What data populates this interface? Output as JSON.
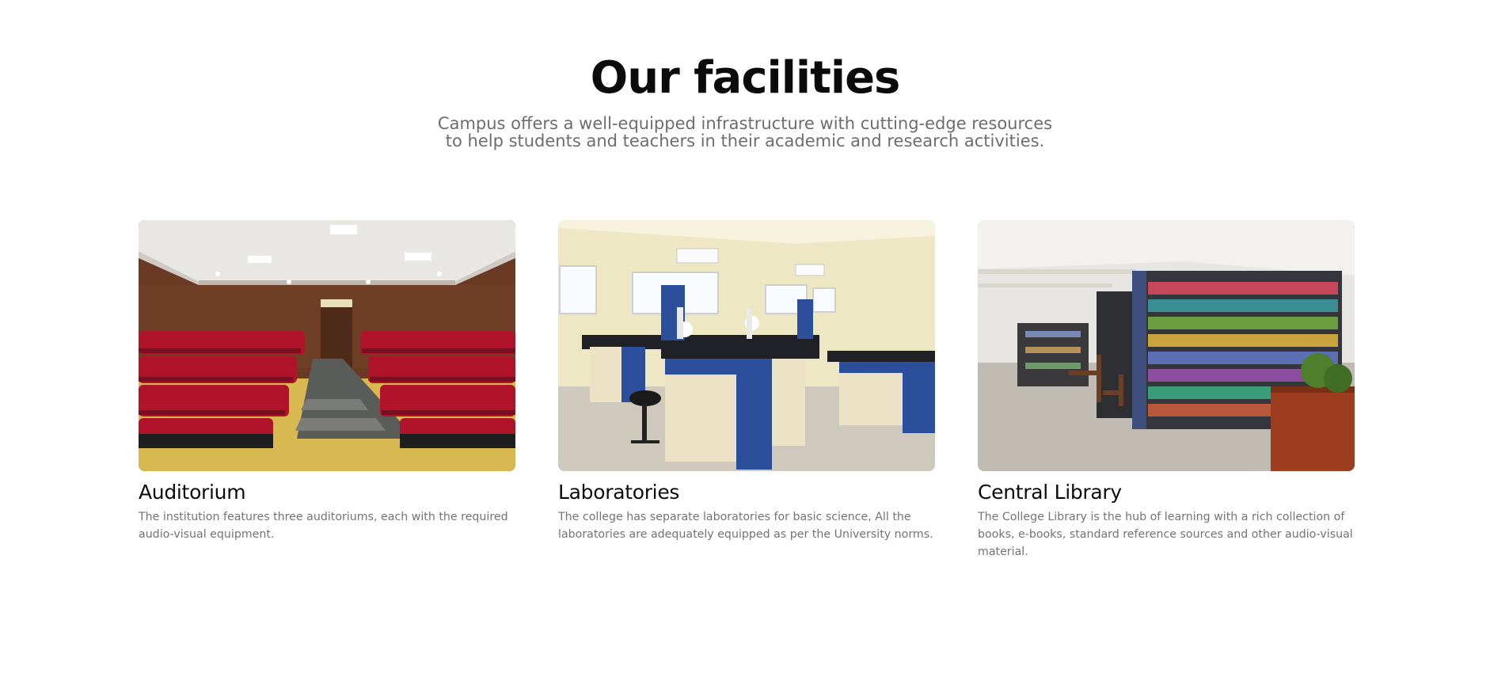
{
  "section": {
    "title": "Our facilities",
    "subtitle": "Campus offers a well-equipped infrastructure with cutting-edge resources to help students and teachers in their academic and research activities."
  },
  "facilities": [
    {
      "title": "Auditorium",
      "description": "The institution features three auditoriums, each with the required audio-visual equipment.",
      "image": "auditorium-photo"
    },
    {
      "title": "Laboratories",
      "description": "The college has separate laboratories for basic science, All the laboratories are adequately equipped as per the University norms.",
      "image": "laboratory-photo"
    },
    {
      "title": "Central Library",
      "description": "The College Library is the hub of learning with a rich collection of books, e-books, standard reference sources and other audio-visual material.",
      "image": "library-photo"
    }
  ]
}
